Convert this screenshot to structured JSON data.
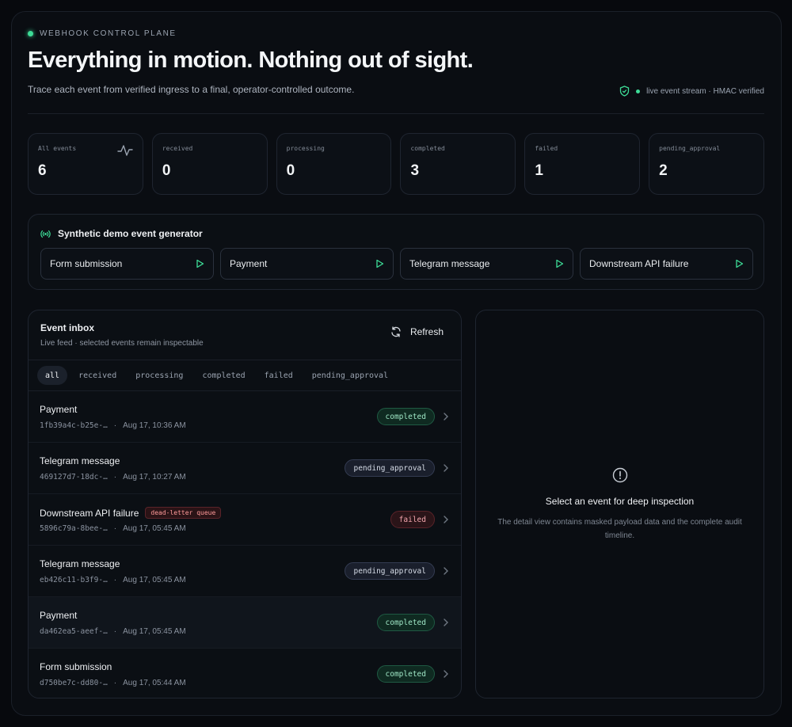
{
  "header": {
    "eyebrow": "WEBHOOK CONTROL PLANE",
    "title": "Everything in motion. Nothing out of sight.",
    "subtitle": "Trace each event from verified ingress to a final, operator-controlled outcome.",
    "status": "live event stream · HMAC verified"
  },
  "stats": [
    {
      "label": "All events",
      "value": "6"
    },
    {
      "label": "received",
      "value": "0"
    },
    {
      "label": "processing",
      "value": "0"
    },
    {
      "label": "completed",
      "value": "3"
    },
    {
      "label": "failed",
      "value": "1"
    },
    {
      "label": "pending_approval",
      "value": "2"
    }
  ],
  "generator": {
    "title": "Synthetic demo event generator",
    "buttons": [
      "Form submission",
      "Payment",
      "Telegram message",
      "Downstream API failure"
    ]
  },
  "inbox": {
    "title": "Event inbox",
    "subtitle": "Live feed · selected events remain inspectable",
    "refresh_label": "Refresh",
    "filters": [
      "all",
      "received",
      "processing",
      "completed",
      "failed",
      "pending_approval"
    ],
    "active_filter": "all",
    "events": [
      {
        "title": "Payment",
        "id": "1fb39a4c-b25e-…",
        "time": "Aug 17, 10:36 AM",
        "status": "completed",
        "tag": ""
      },
      {
        "title": "Telegram message",
        "id": "469127d7-18dc-…",
        "time": "Aug 17, 10:27 AM",
        "status": "pending_approval",
        "tag": ""
      },
      {
        "title": "Downstream API failure",
        "id": "5896c79a-8bee-…",
        "time": "Aug 17, 05:45 AM",
        "status": "failed",
        "tag": "dead-letter queue"
      },
      {
        "title": "Telegram message",
        "id": "eb426c11-b3f9-…",
        "time": "Aug 17, 05:45 AM",
        "status": "pending_approval",
        "tag": ""
      },
      {
        "title": "Payment",
        "id": "da462ea5-aeef-…",
        "time": "Aug 17, 05:45 AM",
        "status": "completed",
        "tag": ""
      },
      {
        "title": "Form submission",
        "id": "d750be7c-dd80-…",
        "time": "Aug 17, 05:44 AM",
        "status": "completed",
        "tag": ""
      }
    ]
  },
  "detail": {
    "empty_title": "Select an event for deep inspection",
    "empty_desc": "The detail view contains masked payload data and the complete audit timeline."
  },
  "colors": {
    "accent": "#3ddc97",
    "failed": "#f3a6ad",
    "background": "#07090d"
  }
}
